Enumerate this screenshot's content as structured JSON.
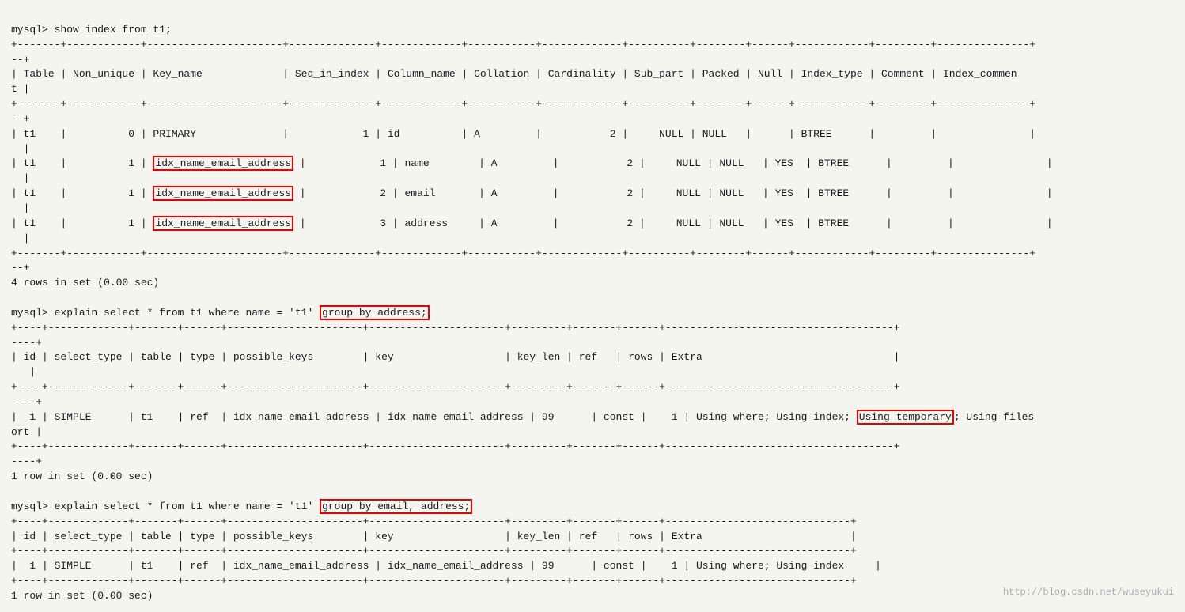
{
  "terminal": {
    "lines": [
      {
        "id": "l1",
        "text": "mysql> show index from t1;",
        "type": "command"
      },
      {
        "id": "l2",
        "text": "+-------+------------+----------------------+--------------+-------------+-----------+-------------+----------+--------+------+------------+---------+---------------+",
        "type": "border"
      },
      {
        "id": "l3",
        "text": "--+",
        "type": "border"
      },
      {
        "id": "l4",
        "text": "| Table | Non_unique | Key_name             | Seq_in_index | Column_name | Collation | Cardinality | Sub_part | Packed | Null | Index_type | Comment | Index_commen",
        "type": "data"
      },
      {
        "id": "l5",
        "text": "t |",
        "type": "data"
      },
      {
        "id": "l6",
        "text": "+-------+------------+----------------------+--------------+-------------+-----------+-------------+----------+--------+------+------------+---------+---------------+",
        "type": "border"
      },
      {
        "id": "l7",
        "text": "--+",
        "type": "border"
      }
    ],
    "watermark": "http://blog.csdn.net/wuseyukui"
  }
}
